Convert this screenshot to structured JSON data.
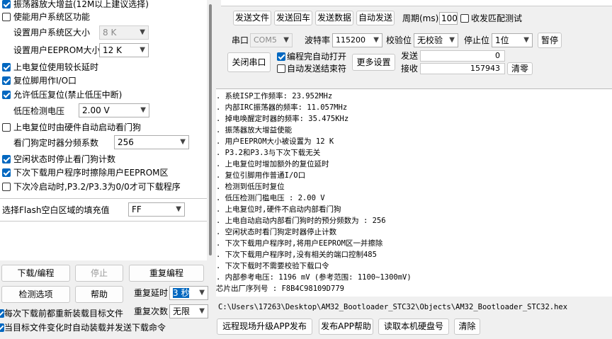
{
  "left_panel": {
    "options": [
      {
        "label": "振荡器放大增益(12M以上建议选择)",
        "checked": true
      },
      {
        "label": "使能用户系统区功能",
        "checked": false
      },
      {
        "label": "上电复位使用较长延时",
        "checked": true
      },
      {
        "label": "复位脚用作I/O口",
        "checked": true
      },
      {
        "label": "允许低压复位(禁止低压中断)",
        "checked": true
      },
      {
        "label": "上电复位时由硬件自动启动看门狗",
        "checked": false
      },
      {
        "label": "空闲状态时停止看门狗计数",
        "checked": true
      },
      {
        "label": "下次下载用户程序时擦除用户EEPROM区",
        "checked": true
      },
      {
        "label": "下次冷启动时,P3.2/P3.3为0/0才可下载程序",
        "checked": false
      }
    ],
    "sys_area_size_label": "设置用户系统区大小",
    "sys_area_size_value": "8   K",
    "eeprom_size_label": "设置用户EEPROM大小",
    "eeprom_size_value": "12   K",
    "low_voltage_label": "低压检测电压",
    "low_voltage_value": "2.00 V",
    "watchdog_label": "看门狗定时器分频系数",
    "watchdog_value": "256",
    "flash_fill_label": "选择Flash空白区域的填充值",
    "flash_fill_value": "FF"
  },
  "bottom_left": {
    "download": "下载/编程",
    "stop": "停止",
    "reprogram": "重复编程",
    "detect": "检测选项",
    "help": "帮助",
    "repeat_delay_label": "重复延时",
    "repeat_delay_value": "3 秒",
    "repeat_count_label": "重复次数",
    "repeat_count_value": "无限",
    "reload_each": "每次下载前都重新装载目标文件",
    "auto_reload": "当目标文件变化时自动装载并发送下载命令"
  },
  "serial": {
    "send_file": "发送文件",
    "send_echo": "发送回车",
    "send_data": "发送数据",
    "auto_send": "自动发送",
    "period_label": "周期(ms)",
    "period_value": "100",
    "match_test": "收发匹配测试",
    "port_label": "串口",
    "port_value": "COM5",
    "baud_label": "波特率",
    "baud_value": "115200",
    "parity_label": "校验位",
    "parity_value": "无校验",
    "stop_label": "停止位",
    "stop_value": "1位",
    "pause": "暂停",
    "close_port": "关闭串口",
    "auto_open": "编程完自动打开",
    "auto_end": "自动发送结束符",
    "more_settings": "更多设置",
    "send_label": "发送",
    "send_count": "0",
    "recv_label": "接收",
    "recv_count": "157943",
    "clear": "清零"
  },
  "log": [
    ". 系统ISP工作频率: 23.952MHz",
    ". 内部IRC振荡器的频率: 11.057MHz",
    ". 掉电唤醒定时器的频率: 35.475KHz",
    ". 振荡器放大增益使能",
    ". 用户EEPROM大小被设置为 12 K",
    ". P3.2和P3.3与下次下载无关",
    ". 上电复位时增加额外的复位延时",
    ". 复位引脚用作普通I/O口",
    ". 检测到低压时复位",
    ". 低压检测门槛电压 : 2.00 V",
    ". 上电复位时,硬件不启动内部看门狗",
    ". 上电自动启动内部看门狗时的预分频数为 : 256",
    ". 空闲状态时看门狗定时器停止计数",
    ". 下次下载用户程序时,将用户EEPROM区一并擦除",
    ". 下次下载用户程序时,没有相关的端口控制485",
    ". 下次下载时不需要校验下载口令",
    ". 内部参考电压: 1196 mV (参考范围: 1100~1300mV)",
    "芯片出厂序列号 : F8B4C98109D779"
  ],
  "file_path": "C:\\Users\\17263\\Desktop\\AM32_Bootloader_STC32\\Objects\\AM32_Bootloader_STC32.hex",
  "bottom_right": {
    "remote_upgrade": "远程现场升级APP发布",
    "publish_help": "发布APP帮助",
    "read_disk": "读取本机硬盘号",
    "clear": "清除"
  }
}
